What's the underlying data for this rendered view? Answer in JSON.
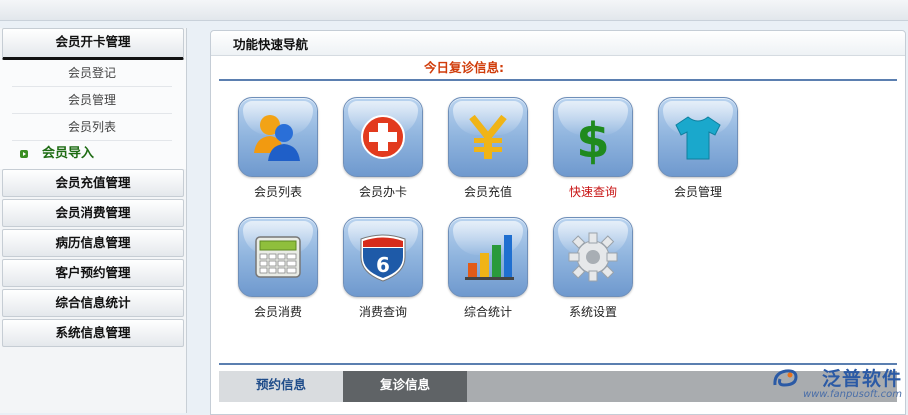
{
  "sidebar": {
    "sections": [
      {
        "label": "会员开卡管理"
      },
      {
        "label": "会员充值管理"
      },
      {
        "label": "会员消费管理"
      },
      {
        "label": "病历信息管理"
      },
      {
        "label": "客户预约管理"
      },
      {
        "label": "综合信息统计"
      },
      {
        "label": "系统信息管理"
      }
    ],
    "sub_items": [
      {
        "label": "会员登记"
      },
      {
        "label": "会员管理"
      },
      {
        "label": "会员列表"
      },
      {
        "label": "会员导入"
      }
    ]
  },
  "main": {
    "title": "功能快速导航",
    "notice": "今日复诊信息:",
    "icons": [
      {
        "label": "会员列表",
        "icon": "members-icon"
      },
      {
        "label": "会员办卡",
        "icon": "add-card-icon"
      },
      {
        "label": "会员充值",
        "icon": "yen-icon"
      },
      {
        "label": "快速查询",
        "icon": "dollar-icon"
      },
      {
        "label": "会员管理",
        "icon": "shirt-icon"
      },
      {
        "label": "会员消费",
        "icon": "calculator-icon"
      },
      {
        "label": "消费查询",
        "icon": "shield-6-icon"
      },
      {
        "label": "综合统计",
        "icon": "bar-chart-icon"
      },
      {
        "label": "系统设置",
        "icon": "gear-icon"
      }
    ],
    "tabs": [
      {
        "label": "预约信息"
      },
      {
        "label": "复诊信息"
      }
    ]
  },
  "brand": {
    "name": "泛普软件",
    "url": "www.fanpusoft.com"
  },
  "colors": {
    "accent_red": "#c81414",
    "notice": "#d03c0a",
    "tab_active": "#5f6366",
    "divider": "#5b7fb0"
  }
}
